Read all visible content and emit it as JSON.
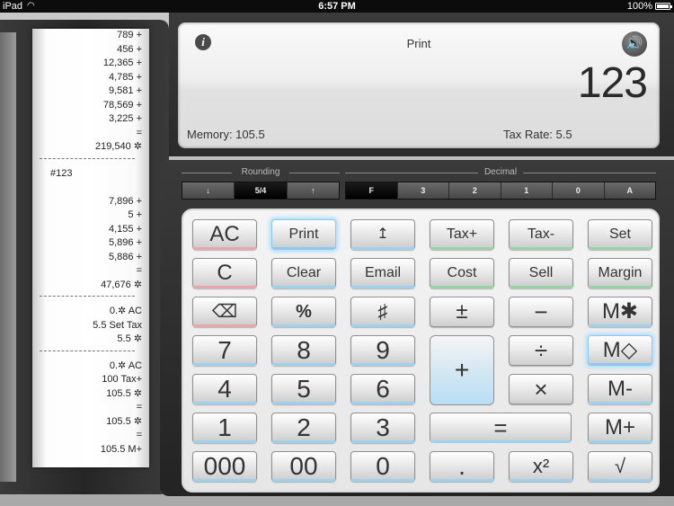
{
  "status_bar": {
    "carrier": "iPad",
    "time": "6:57 PM",
    "battery": "100%"
  },
  "tape": [
    {
      "text": "789 +"
    },
    {
      "text": "456 +"
    },
    {
      "text": "12,365 +"
    },
    {
      "text": "4,785 +"
    },
    {
      "text": "9,581 +"
    },
    {
      "text": "78,569 +"
    },
    {
      "text": "3,225 +"
    },
    {
      "text": "="
    },
    {
      "text": "219,540 ✲"
    },
    {
      "sep": true
    },
    {
      "text": "#123",
      "tag": true
    },
    {
      "text": ""
    },
    {
      "text": "7,896 +"
    },
    {
      "text": "5 +"
    },
    {
      "text": "4,155 +"
    },
    {
      "text": "5,896 +"
    },
    {
      "text": "5,886 +"
    },
    {
      "text": "="
    },
    {
      "text": "47,676 ✲"
    },
    {
      "sep": true
    },
    {
      "text": "0.✲ AC"
    },
    {
      "text": "5.5 Set Tax"
    },
    {
      "text": "5.5 ✲"
    },
    {
      "sep": true
    },
    {
      "text": "0.✲ AC"
    },
    {
      "text": "100 Tax+"
    },
    {
      "text": "105.5 ✲"
    },
    {
      "text": "="
    },
    {
      "text": "105.5 ✲"
    },
    {
      "text": "="
    },
    {
      "text": "105.5 M+"
    }
  ],
  "display": {
    "info_glyph": "i",
    "sound_glyph": "🔊",
    "mode_label": "Print",
    "value": "123",
    "memory": "Memory:  105.5",
    "tax_rate": "Tax Rate:  5.5"
  },
  "rounding": {
    "title": "Rounding",
    "options": [
      "↓",
      "5/4",
      "↑"
    ]
  },
  "decimal": {
    "title": "Decimal",
    "options": [
      "F",
      "3",
      "2",
      "1",
      "0",
      "A"
    ]
  },
  "keys": {
    "ac": "AC",
    "print": "Print",
    "paper_feed": "↥",
    "tax_plus": "Tax+",
    "tax_minus": "Tax-",
    "set": "Set",
    "c": "C",
    "clear": "Clear",
    "email": "Email",
    "cost": "Cost",
    "sell": "Sell",
    "margin": "Margin",
    "backspace": "⌫",
    "percent": "%",
    "hash": "♯",
    "plus_minus": "±",
    "minus": "−",
    "m_times": "M✱",
    "seven": "7",
    "eight": "8",
    "nine": "9",
    "plus": "+",
    "divide": "÷",
    "m_recall": "M◇",
    "four": "4",
    "five": "5",
    "six": "6",
    "times": "×",
    "m_minus": "M-",
    "one": "1",
    "two": "2",
    "three": "3",
    "equals": "=",
    "m_plus": "M+",
    "triple_zero": "000",
    "double_zero": "00",
    "zero": "0",
    "decimal_point": ".",
    "square": "x²",
    "sqrt": "√"
  }
}
